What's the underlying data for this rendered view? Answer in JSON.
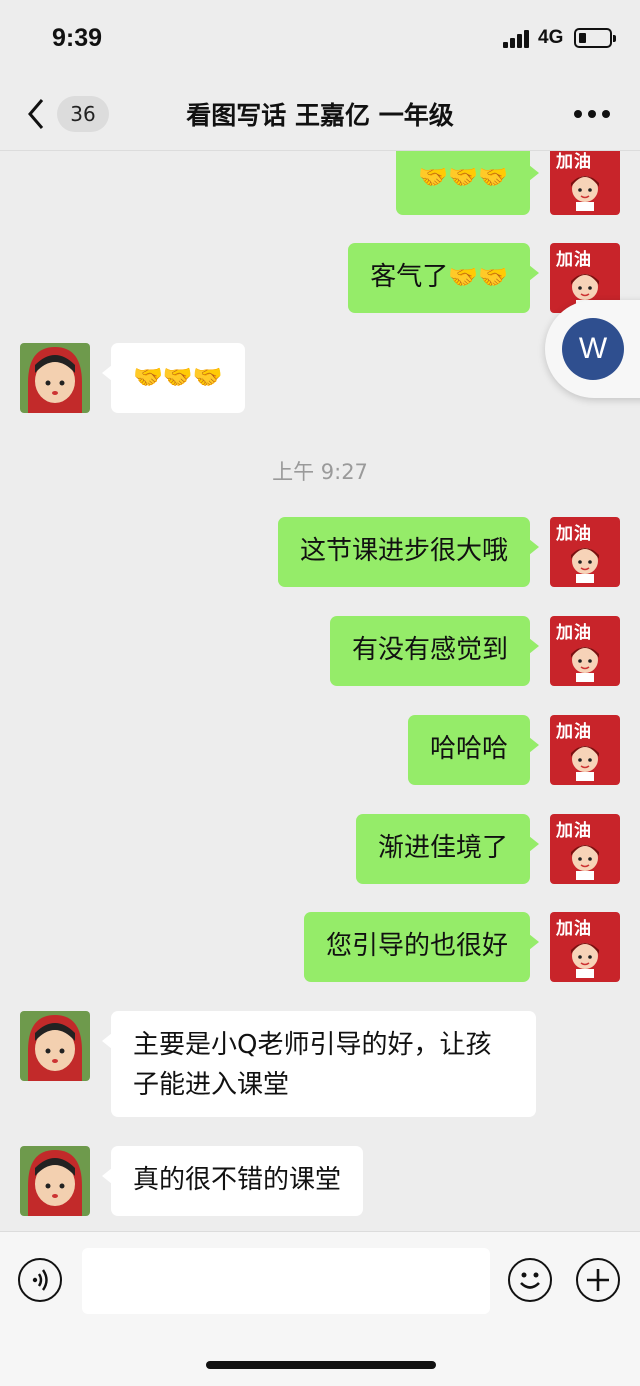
{
  "status_bar": {
    "time": "9:39",
    "network": "4G"
  },
  "nav": {
    "unread_count": "36",
    "title": "看图写话 王嘉亿 一年级"
  },
  "avatar_me_text": "加油",
  "floating_letter": "W",
  "messages": [
    {
      "from": "me",
      "text": "",
      "handshakes": 3
    },
    {
      "from": "me",
      "text": "客气了",
      "handshakes": 2
    },
    {
      "from": "other",
      "text": "",
      "handshakes": 3
    },
    {
      "type": "timestamp",
      "text": "上午 9:27"
    },
    {
      "from": "me",
      "text": "这节课进步很大哦"
    },
    {
      "from": "me",
      "text": "有没有感觉到"
    },
    {
      "from": "me",
      "text": "哈哈哈"
    },
    {
      "from": "me",
      "text": "渐进佳境了"
    },
    {
      "from": "me",
      "text": "您引导的也很好"
    },
    {
      "from": "other",
      "text": "主要是小Q老师引导的好，让孩子能进入课堂"
    },
    {
      "from": "other",
      "text": "真的很不错的课堂"
    }
  ],
  "input": {
    "value": "",
    "placeholder": ""
  },
  "icons": {
    "back": "chevron-left-icon",
    "more": "more-dots-icon",
    "voice": "voice-icon",
    "emoji": "emoji-icon",
    "plus": "plus-icon",
    "handshake": "🤝"
  },
  "colors": {
    "my_bubble": "#95ec69",
    "other_bubble": "#ffffff",
    "background": "#ededed"
  }
}
